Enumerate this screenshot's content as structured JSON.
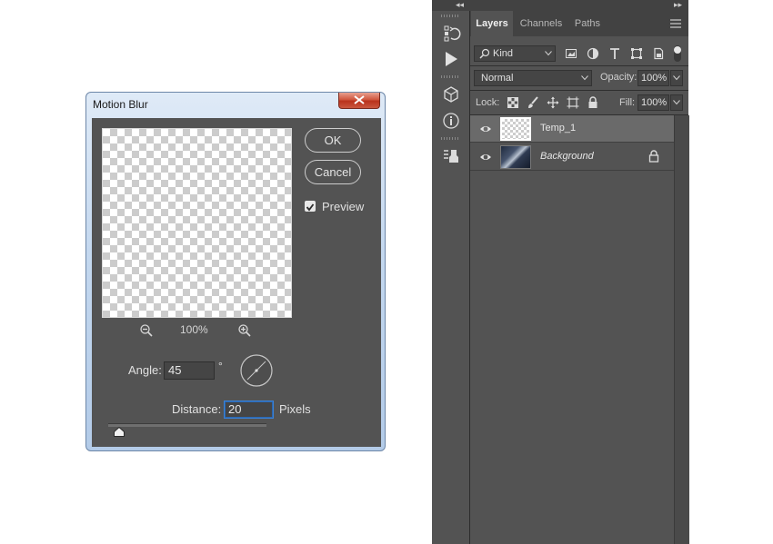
{
  "dialog": {
    "title": "Motion Blur",
    "ok_label": "OK",
    "cancel_label": "Cancel",
    "preview_label": "Preview",
    "preview_checked": true,
    "zoom_level": "100%",
    "angle_label": "Angle:",
    "angle_value": "45",
    "degree_symbol": "°",
    "distance_label": "Distance:",
    "distance_value": "20",
    "distance_unit": "Pixels",
    "distance_slider_fraction": 0.07
  },
  "panel": {
    "tabs": [
      "Layers",
      "Channels",
      "Paths"
    ],
    "active_tab": "Layers",
    "filter_kind": "Kind",
    "blend_mode": "Normal",
    "opacity_label": "Opacity:",
    "opacity_value": "100%",
    "lock_label": "Lock:",
    "fill_label": "Fill:",
    "fill_value": "100%",
    "layers": [
      {
        "name": "Temp_1",
        "visible": true,
        "selected": true
      },
      {
        "name": "Background",
        "visible": true,
        "locked": true
      }
    ]
  },
  "icons": {
    "toolstrip": [
      "history-icon",
      "actions-play-icon",
      "3d-icon",
      "info-icon",
      "properties-icon"
    ],
    "filters": [
      "pixel-layer-filter-icon",
      "adjustment-filter-icon",
      "type-filter-icon",
      "shape-filter-icon",
      "smart-object-filter-icon"
    ],
    "locks": [
      "lock-transparent-pixels-icon",
      "lock-image-pixels-icon",
      "lock-position-icon",
      "lock-artboard-icon",
      "lock-all-icon"
    ]
  },
  "colors": {
    "panel_bg": "#535353",
    "selected_layer": "#6a6a6a",
    "focus_blue": "#3b82d6"
  }
}
